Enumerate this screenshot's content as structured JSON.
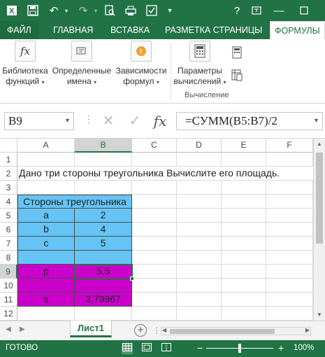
{
  "qat": {
    "icons": [
      "excel-logo-icon",
      "save-icon",
      "undo-icon",
      "redo-icon",
      "print-preview-icon",
      "quick-print-icon",
      "customize-icon"
    ],
    "window": [
      "help-icon",
      "restore-icon",
      "minimize-icon"
    ]
  },
  "tabs": {
    "file": "ФАЙЛ",
    "home": "ГЛАВНАЯ",
    "insert": "ВСТАВКА",
    "layout": "РАЗМЕТКА СТРАНИЦЫ",
    "formulas": "ФОРМУЛЫ"
  },
  "ribbon": {
    "library": {
      "line1": "Библиотека",
      "line2": "функций"
    },
    "names": {
      "line1": "Определенные",
      "line2": "имена"
    },
    "dependencies": {
      "line1": "Зависимости",
      "line2": "формул"
    },
    "params": {
      "line1": "Параметры",
      "line2": "вычислений"
    },
    "group": "Вычисление"
  },
  "formula_bar": {
    "name_box": "B9",
    "fx": "fx",
    "formula": "=СУММ(B5:B7)/2"
  },
  "grid": {
    "columns": [
      "A",
      "B",
      "C",
      "D",
      "E",
      "F"
    ],
    "rows": [
      "1",
      "2",
      "3",
      "4",
      "5",
      "6",
      "7",
      "8",
      "9",
      "10",
      "11",
      "12"
    ],
    "selected_column": "B",
    "selected_row": "9",
    "task": "Дано три стороны треугольника Вычислите его площадь.",
    "header": "Стороны треугольника",
    "a_label": "a",
    "a_value": "2",
    "b_label": "b",
    "b_value": "4",
    "c_label": "c",
    "c_value": "5",
    "p_label": "p",
    "p_value": "5,5",
    "s_label": "s",
    "s_value": "3,79967"
  },
  "sheets": {
    "active": "Лист1"
  },
  "status": {
    "ready": "ГОТОВО",
    "zoom": "100%"
  },
  "colors": {
    "accent": "#217346",
    "blue_fill": "#65c4f5",
    "magenta_fill": "#cc00cc"
  }
}
